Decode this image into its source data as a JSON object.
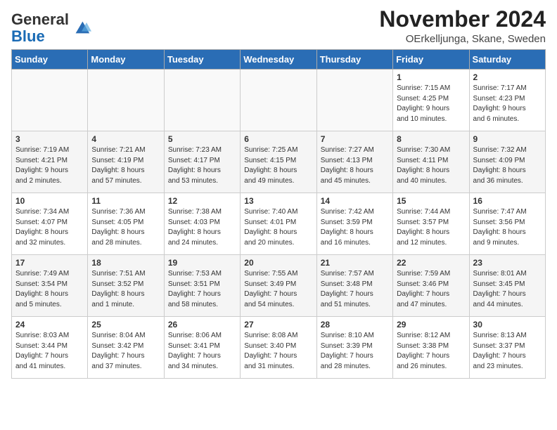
{
  "header": {
    "logo_general": "General",
    "logo_blue": "Blue",
    "title": "November 2024",
    "location": "OErkelljunga, Skane, Sweden"
  },
  "columns": [
    "Sunday",
    "Monday",
    "Tuesday",
    "Wednesday",
    "Thursday",
    "Friday",
    "Saturday"
  ],
  "weeks": [
    [
      {
        "day": "",
        "info": ""
      },
      {
        "day": "",
        "info": ""
      },
      {
        "day": "",
        "info": ""
      },
      {
        "day": "",
        "info": ""
      },
      {
        "day": "",
        "info": ""
      },
      {
        "day": "1",
        "info": "Sunrise: 7:15 AM\nSunset: 4:25 PM\nDaylight: 9 hours\nand 10 minutes."
      },
      {
        "day": "2",
        "info": "Sunrise: 7:17 AM\nSunset: 4:23 PM\nDaylight: 9 hours\nand 6 minutes."
      }
    ],
    [
      {
        "day": "3",
        "info": "Sunrise: 7:19 AM\nSunset: 4:21 PM\nDaylight: 9 hours\nand 2 minutes."
      },
      {
        "day": "4",
        "info": "Sunrise: 7:21 AM\nSunset: 4:19 PM\nDaylight: 8 hours\nand 57 minutes."
      },
      {
        "day": "5",
        "info": "Sunrise: 7:23 AM\nSunset: 4:17 PM\nDaylight: 8 hours\nand 53 minutes."
      },
      {
        "day": "6",
        "info": "Sunrise: 7:25 AM\nSunset: 4:15 PM\nDaylight: 8 hours\nand 49 minutes."
      },
      {
        "day": "7",
        "info": "Sunrise: 7:27 AM\nSunset: 4:13 PM\nDaylight: 8 hours\nand 45 minutes."
      },
      {
        "day": "8",
        "info": "Sunrise: 7:30 AM\nSunset: 4:11 PM\nDaylight: 8 hours\nand 40 minutes."
      },
      {
        "day": "9",
        "info": "Sunrise: 7:32 AM\nSunset: 4:09 PM\nDaylight: 8 hours\nand 36 minutes."
      }
    ],
    [
      {
        "day": "10",
        "info": "Sunrise: 7:34 AM\nSunset: 4:07 PM\nDaylight: 8 hours\nand 32 minutes."
      },
      {
        "day": "11",
        "info": "Sunrise: 7:36 AM\nSunset: 4:05 PM\nDaylight: 8 hours\nand 28 minutes."
      },
      {
        "day": "12",
        "info": "Sunrise: 7:38 AM\nSunset: 4:03 PM\nDaylight: 8 hours\nand 24 minutes."
      },
      {
        "day": "13",
        "info": "Sunrise: 7:40 AM\nSunset: 4:01 PM\nDaylight: 8 hours\nand 20 minutes."
      },
      {
        "day": "14",
        "info": "Sunrise: 7:42 AM\nSunset: 3:59 PM\nDaylight: 8 hours\nand 16 minutes."
      },
      {
        "day": "15",
        "info": "Sunrise: 7:44 AM\nSunset: 3:57 PM\nDaylight: 8 hours\nand 12 minutes."
      },
      {
        "day": "16",
        "info": "Sunrise: 7:47 AM\nSunset: 3:56 PM\nDaylight: 8 hours\nand 9 minutes."
      }
    ],
    [
      {
        "day": "17",
        "info": "Sunrise: 7:49 AM\nSunset: 3:54 PM\nDaylight: 8 hours\nand 5 minutes."
      },
      {
        "day": "18",
        "info": "Sunrise: 7:51 AM\nSunset: 3:52 PM\nDaylight: 8 hours\nand 1 minute."
      },
      {
        "day": "19",
        "info": "Sunrise: 7:53 AM\nSunset: 3:51 PM\nDaylight: 7 hours\nand 58 minutes."
      },
      {
        "day": "20",
        "info": "Sunrise: 7:55 AM\nSunset: 3:49 PM\nDaylight: 7 hours\nand 54 minutes."
      },
      {
        "day": "21",
        "info": "Sunrise: 7:57 AM\nSunset: 3:48 PM\nDaylight: 7 hours\nand 51 minutes."
      },
      {
        "day": "22",
        "info": "Sunrise: 7:59 AM\nSunset: 3:46 PM\nDaylight: 7 hours\nand 47 minutes."
      },
      {
        "day": "23",
        "info": "Sunrise: 8:01 AM\nSunset: 3:45 PM\nDaylight: 7 hours\nand 44 minutes."
      }
    ],
    [
      {
        "day": "24",
        "info": "Sunrise: 8:03 AM\nSunset: 3:44 PM\nDaylight: 7 hours\nand 41 minutes."
      },
      {
        "day": "25",
        "info": "Sunrise: 8:04 AM\nSunset: 3:42 PM\nDaylight: 7 hours\nand 37 minutes."
      },
      {
        "day": "26",
        "info": "Sunrise: 8:06 AM\nSunset: 3:41 PM\nDaylight: 7 hours\nand 34 minutes."
      },
      {
        "day": "27",
        "info": "Sunrise: 8:08 AM\nSunset: 3:40 PM\nDaylight: 7 hours\nand 31 minutes."
      },
      {
        "day": "28",
        "info": "Sunrise: 8:10 AM\nSunset: 3:39 PM\nDaylight: 7 hours\nand 28 minutes."
      },
      {
        "day": "29",
        "info": "Sunrise: 8:12 AM\nSunset: 3:38 PM\nDaylight: 7 hours\nand 26 minutes."
      },
      {
        "day": "30",
        "info": "Sunrise: 8:13 AM\nSunset: 3:37 PM\nDaylight: 7 hours\nand 23 minutes."
      }
    ]
  ]
}
